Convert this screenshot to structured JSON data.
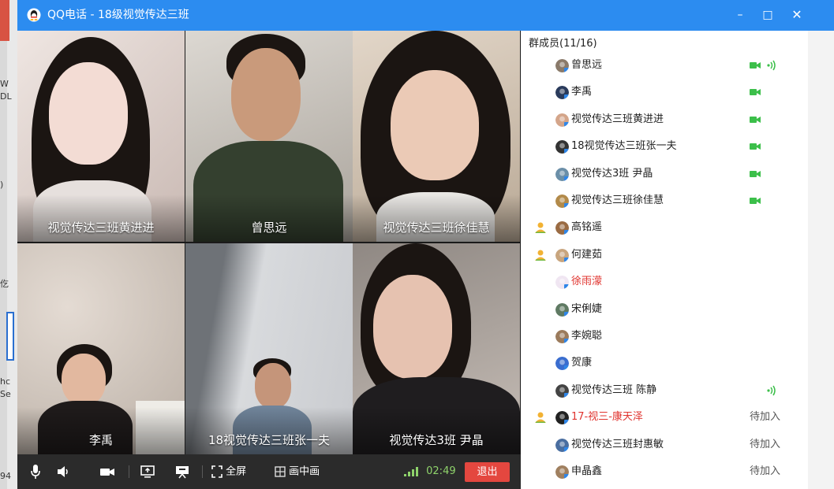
{
  "window": {
    "title": "QQ电话 - 18级视觉传达三班",
    "minimize_glyph": "–",
    "maximize_glyph": "□",
    "close_glyph": "✕"
  },
  "desktop": {
    "fragments": [
      "W",
      "DL",
      ")",
      "仡",
      "hc",
      "Se",
      "94"
    ]
  },
  "video_tiles": [
    {
      "name": "视觉传达三班黄进进",
      "bg": "#d9c9c4",
      "skin": "#f1d9d1",
      "shirt": "#e8e4e2"
    },
    {
      "name": "曾思远",
      "bg": "#c9c4bd",
      "skin": "#c99b7c",
      "shirt": "#2f3a2b"
    },
    {
      "name": "视觉传达三班徐佳慧",
      "bg": "#c5b6a6",
      "skin": "#e8c8b4",
      "shirt": "#2a2624"
    },
    {
      "name": "李禹",
      "bg": "#cdc3ba",
      "skin": "#e0b7a0",
      "shirt": "#1f1b1b"
    },
    {
      "name": "18视觉传达三班张一夫",
      "bg": "#b9bcc2",
      "skin": "#c5957a",
      "shirt": "#6f8191"
    },
    {
      "name": "视觉传达3班 尹晶",
      "bg": "#a69f99",
      "skin": "#e5c0ae",
      "shirt": "#1f1d1f"
    }
  ],
  "controls": {
    "fullscreen_label": "全屏",
    "pip_label": "画中画",
    "call_time": "02:49",
    "exit_label": "退出",
    "signal_color": "#8fd36b",
    "exit_color": "#e4473f"
  },
  "members": {
    "header": "群成员(11/16)",
    "list": [
      {
        "name": "曾思远",
        "camera": true,
        "speaking": true,
        "host": false,
        "red": false,
        "pending": "",
        "avatar": "#8a7a6a"
      },
      {
        "name": "李禹",
        "camera": true,
        "speaking": false,
        "host": false,
        "red": false,
        "pending": "",
        "avatar": "#2a3b5c"
      },
      {
        "name": "视觉传达三班黄进进",
        "camera": true,
        "speaking": false,
        "host": false,
        "red": false,
        "pending": "",
        "avatar": "#d4a58a"
      },
      {
        "name": "18视觉传达三班张一夫",
        "camera": true,
        "speaking": false,
        "host": false,
        "red": false,
        "pending": "",
        "avatar": "#333333"
      },
      {
        "name": "视觉传达3班 尹晶",
        "camera": true,
        "speaking": false,
        "host": false,
        "red": false,
        "pending": "",
        "avatar": "#6b8fa8"
      },
      {
        "name": "视觉传达三班徐佳慧",
        "camera": true,
        "speaking": false,
        "host": false,
        "red": false,
        "pending": "",
        "avatar": "#b28a4a"
      },
      {
        "name": "高铭遥",
        "camera": false,
        "speaking": false,
        "host": true,
        "red": false,
        "pending": "",
        "avatar": "#9a6b43"
      },
      {
        "name": "何建茹",
        "camera": false,
        "speaking": false,
        "host": true,
        "red": false,
        "pending": "",
        "avatar": "#c8a57e"
      },
      {
        "name": "徐雨濛",
        "camera": false,
        "speaking": false,
        "host": false,
        "red": true,
        "pending": "",
        "avatar": "#f0e6f2"
      },
      {
        "name": "宋俐婕",
        "camera": false,
        "speaking": false,
        "host": false,
        "red": false,
        "pending": "",
        "avatar": "#5f7a63"
      },
      {
        "name": "李婉聪",
        "camera": false,
        "speaking": false,
        "host": false,
        "red": false,
        "pending": "",
        "avatar": "#9b7b5c"
      },
      {
        "name": "贺康",
        "camera": false,
        "speaking": false,
        "host": false,
        "red": false,
        "pending": "",
        "avatar": "#3a6dcf"
      },
      {
        "name": "视觉传达三班 陈静",
        "camera": false,
        "speaking": true,
        "host": false,
        "red": false,
        "pending": "",
        "avatar": "#444444"
      },
      {
        "name": "17-视三-康天泽",
        "camera": false,
        "speaking": false,
        "host": true,
        "red": true,
        "pending": "待加入",
        "avatar": "#222222"
      },
      {
        "name": "视觉传达三班封惠敏",
        "camera": false,
        "speaking": false,
        "host": false,
        "red": false,
        "pending": "待加入",
        "avatar": "#4a6ea0"
      },
      {
        "name": "申晶鑫",
        "camera": false,
        "speaking": false,
        "host": false,
        "red": false,
        "pending": "待加入",
        "avatar": "#a08060"
      }
    ]
  }
}
